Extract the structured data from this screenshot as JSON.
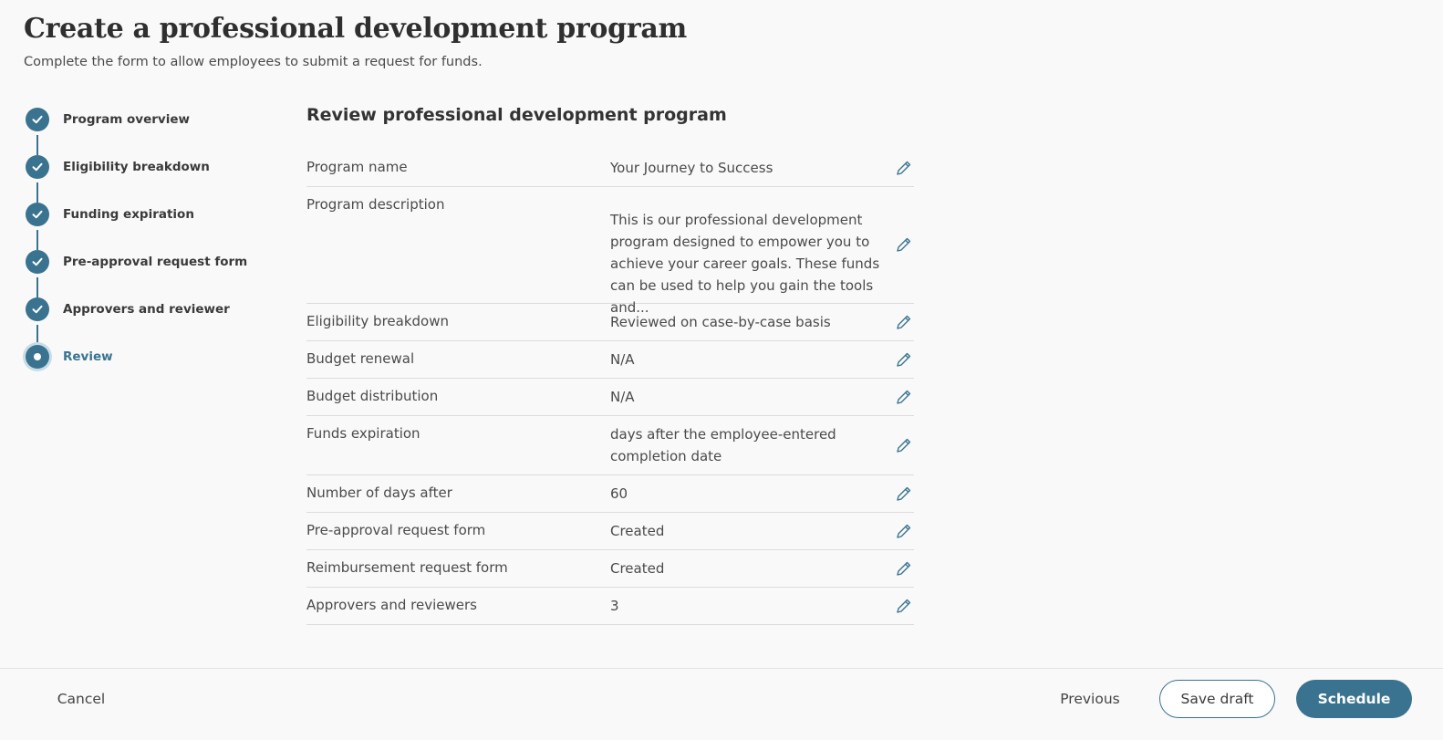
{
  "header": {
    "title": "Create a professional development program",
    "subtitle": "Complete the form to allow employees to submit a request for funds."
  },
  "stepper": {
    "steps": [
      {
        "label": "Program overview",
        "status": "complete"
      },
      {
        "label": "Eligibility breakdown",
        "status": "complete"
      },
      {
        "label": "Funding expiration",
        "status": "complete"
      },
      {
        "label": "Pre-approval request form",
        "status": "complete"
      },
      {
        "label": "Approvers and reviewer",
        "status": "complete"
      },
      {
        "label": "Review",
        "status": "current"
      }
    ]
  },
  "review": {
    "title": "Review professional development program",
    "rows": [
      {
        "label": "Program name",
        "value": "Your Journey to Success"
      },
      {
        "label": "Program description",
        "value": "This is our professional development program designed to empower you to achieve your career goals. These funds can be used to help you gain the tools and..."
      },
      {
        "label": "Eligibility breakdown",
        "value": "Reviewed on case-by-case basis"
      },
      {
        "label": "Budget renewal",
        "value": "N/A"
      },
      {
        "label": "Budget distribution",
        "value": "N/A"
      },
      {
        "label": "Funds expiration",
        "value": "days after the employee-entered completion date"
      },
      {
        "label": "Number of days after",
        "value": "60"
      },
      {
        "label": "Pre-approval request form",
        "value": "Created"
      },
      {
        "label": "Reimbursement request form",
        "value": "Created"
      },
      {
        "label": "Approvers and reviewers",
        "value": "3"
      }
    ]
  },
  "footer": {
    "cancel_label": "Cancel",
    "previous_label": "Previous",
    "save_draft_label": "Save draft",
    "schedule_label": "Schedule"
  },
  "colors": {
    "accent": "#3a7390",
    "background": "#f9f9f9",
    "divider": "#dcdcdc"
  },
  "icons": {
    "step_complete": "check-icon",
    "step_current": "dot-icon",
    "row_edit": "pencil-icon"
  }
}
